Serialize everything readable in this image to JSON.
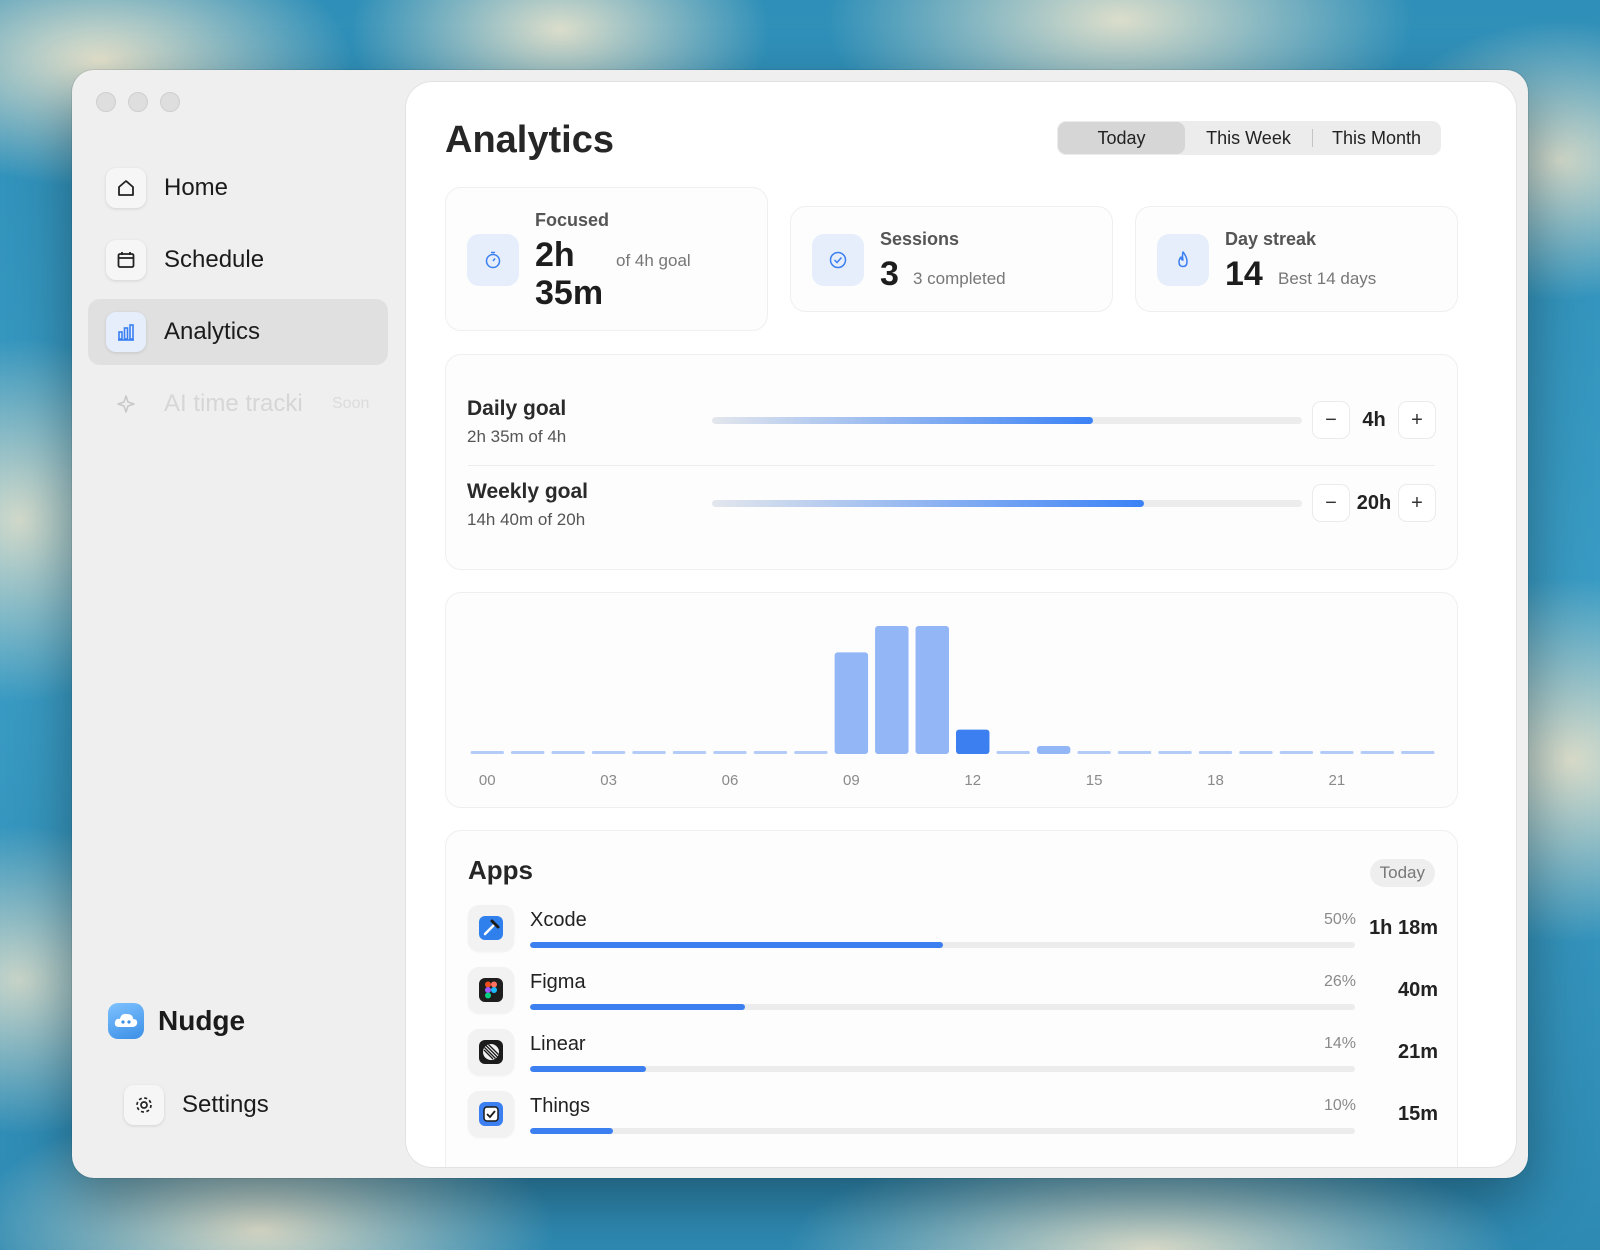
{
  "sidebar": {
    "items": [
      {
        "label": "Home",
        "icon": "home-icon"
      },
      {
        "label": "Schedule",
        "icon": "calendar-icon"
      },
      {
        "label": "Analytics",
        "icon": "bar-chart-icon"
      },
      {
        "label": "AI time tracking",
        "icon": "sparkle-icon",
        "badge": "Soon"
      }
    ],
    "brand": "Nudge",
    "settings": "Settings"
  },
  "header": {
    "title": "Analytics",
    "ranges": [
      "Today",
      "This Week",
      "This Month"
    ],
    "selected_range": "Today"
  },
  "stats": {
    "focused": {
      "label": "Focused",
      "value": "2h 35m",
      "sub": "of 4h goal"
    },
    "sessions": {
      "label": "Sessions",
      "value": "3",
      "sub": "3 completed"
    },
    "streak": {
      "label": "Day streak",
      "value": "14",
      "sub": "Best 14 days"
    }
  },
  "goals": {
    "daily": {
      "title": "Daily goal",
      "sub": "2h 35m of 4h",
      "value": "4h",
      "progress": 0.646
    },
    "weekly": {
      "title": "Weekly goal",
      "sub": "14h 40m of 20h",
      "value": "20h",
      "progress": 0.733
    },
    "minus": "−",
    "plus": "+"
  },
  "chart_data": {
    "type": "bar",
    "categories": [
      "00",
      "01",
      "02",
      "03",
      "04",
      "05",
      "06",
      "07",
      "08",
      "09",
      "10",
      "11",
      "12",
      "13",
      "14",
      "15",
      "16",
      "17",
      "18",
      "19",
      "20",
      "21",
      "22",
      "23"
    ],
    "tick_labels": [
      "00",
      "03",
      "06",
      "09",
      "12",
      "15",
      "18",
      "21"
    ],
    "values": [
      0,
      0,
      0,
      0,
      0,
      0,
      0,
      0,
      0,
      50,
      63,
      63,
      12,
      0,
      3,
      0,
      0,
      0,
      0,
      0,
      0,
      0,
      0,
      0
    ],
    "highlight_index": 12,
    "ylim": [
      0,
      63
    ],
    "colors": {
      "bar": "#93b6f7",
      "highlight": "#3b7ff0",
      "baseline": "#b3cbf7"
    }
  },
  "apps": {
    "title": "Apps",
    "badge": "Today",
    "items": [
      {
        "name": "Xcode",
        "pct": "50%",
        "time": "1h 18m",
        "fraction": 0.5,
        "icon": "xcode-icon"
      },
      {
        "name": "Figma",
        "pct": "26%",
        "time": "40m",
        "fraction": 0.26,
        "icon": "figma-icon"
      },
      {
        "name": "Linear",
        "pct": "14%",
        "time": "21m",
        "fraction": 0.14,
        "icon": "linear-icon"
      },
      {
        "name": "Things",
        "pct": "10%",
        "time": "15m",
        "fraction": 0.1,
        "icon": "things-icon"
      }
    ]
  }
}
